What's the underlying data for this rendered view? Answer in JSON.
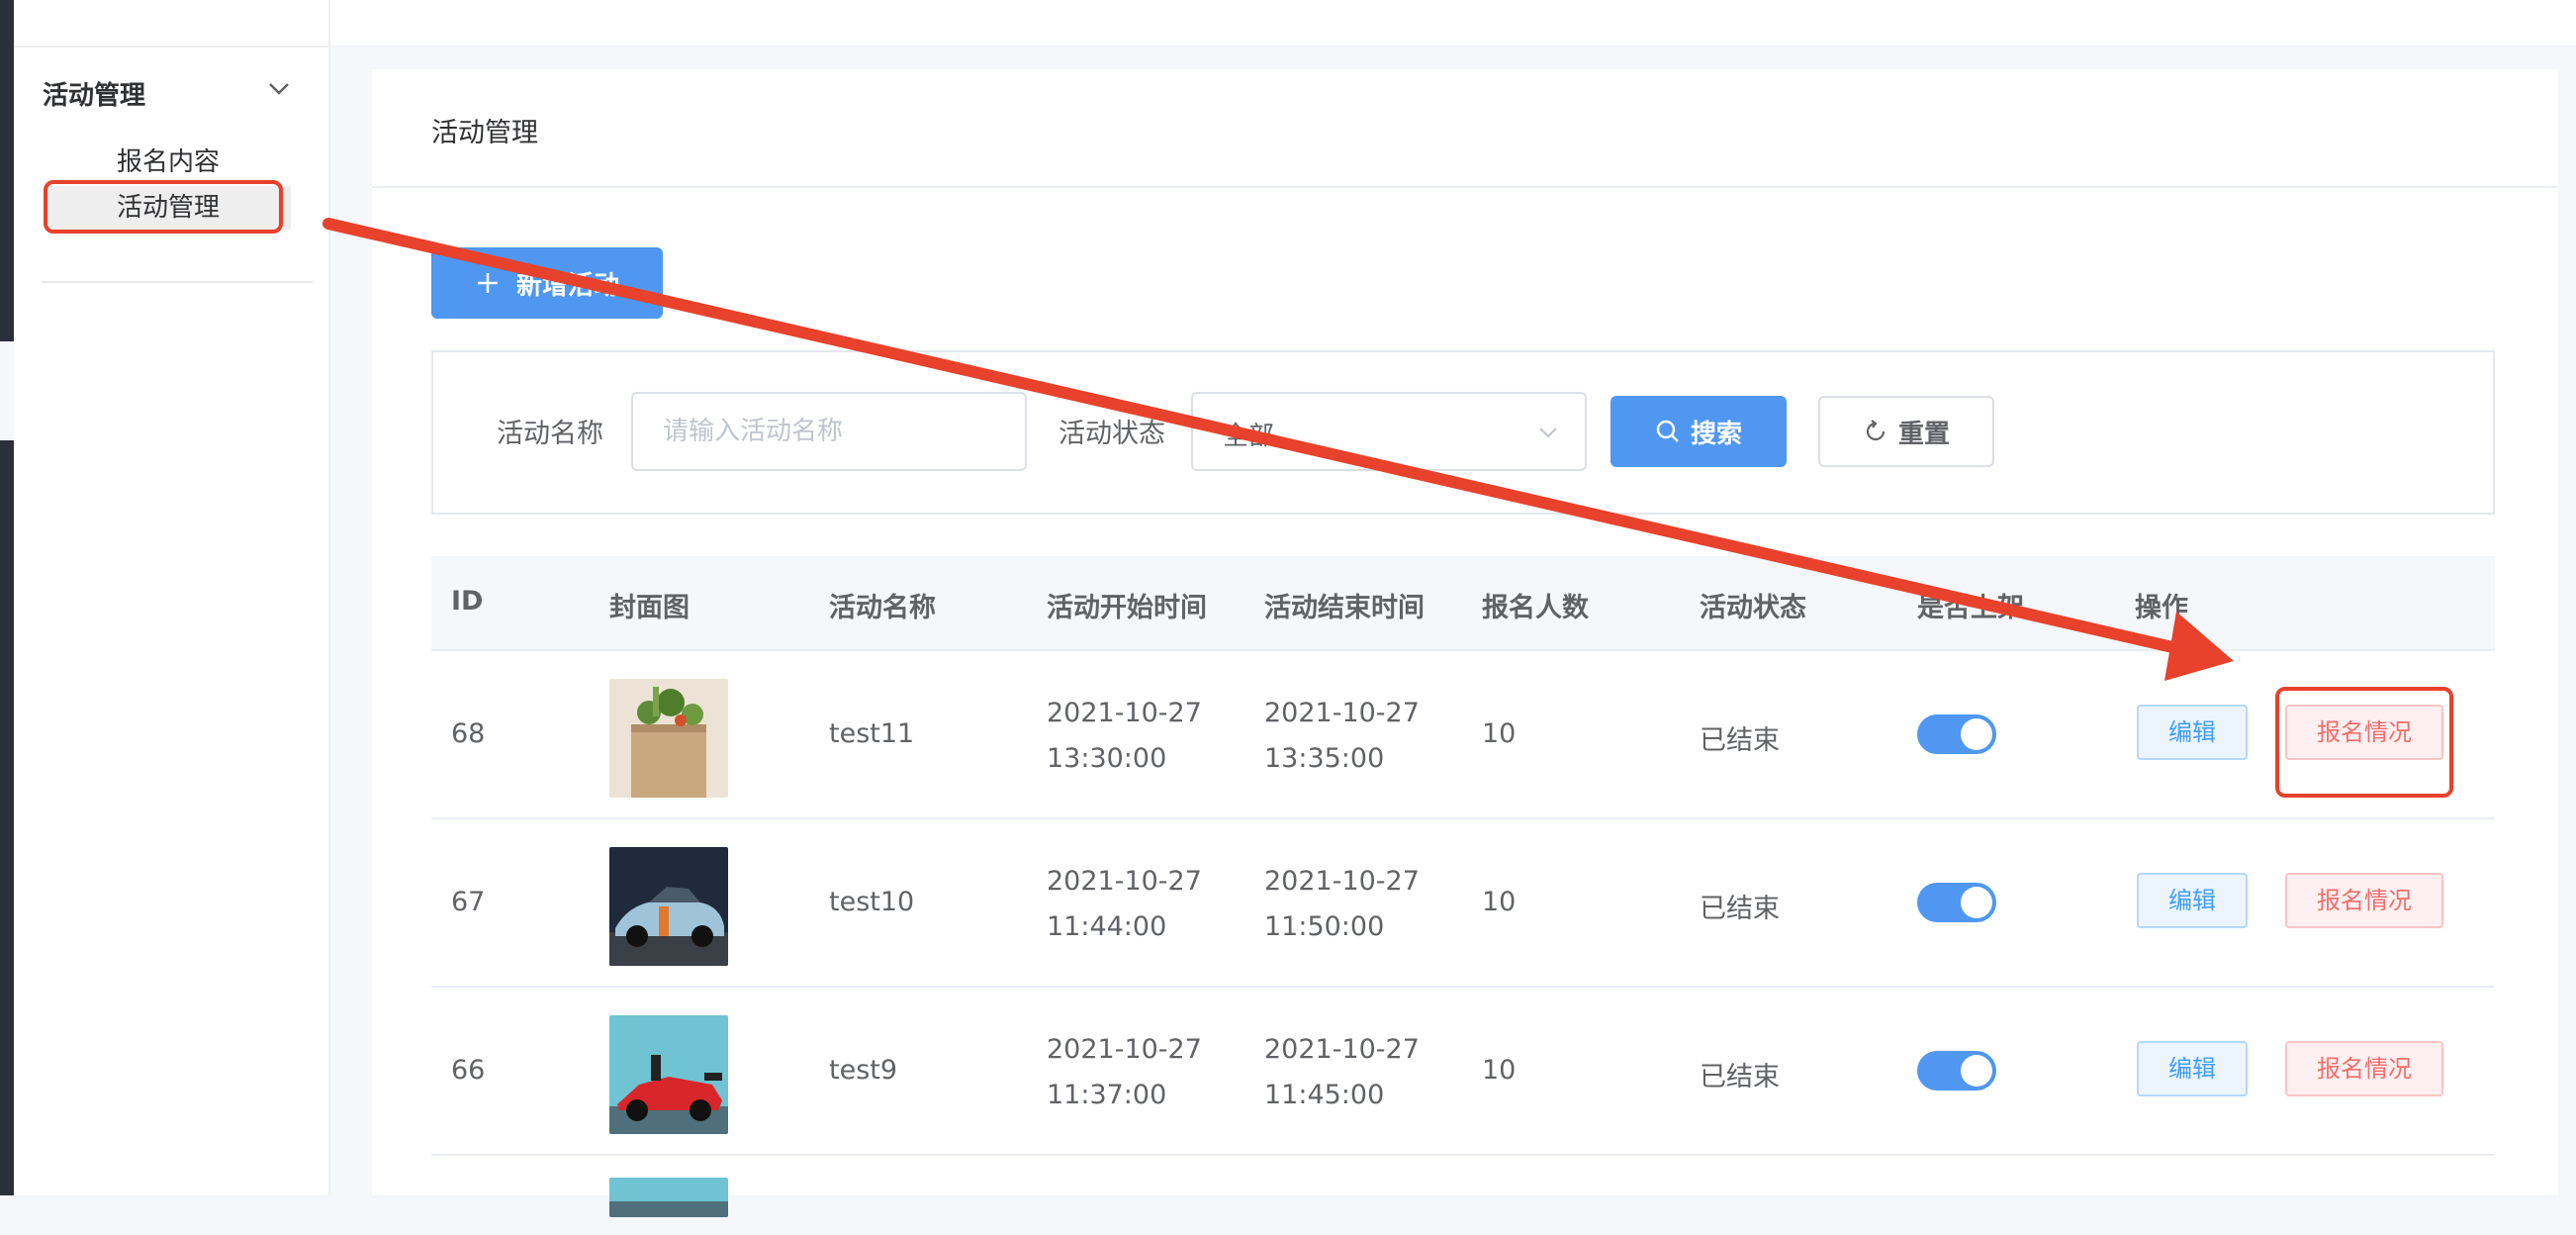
{
  "sidebar": {
    "group_title": "活动管理",
    "items": [
      {
        "label": "报名内容"
      },
      {
        "label": "活动管理"
      }
    ]
  },
  "card": {
    "title": "活动管理",
    "add_button": "新增活动"
  },
  "filter": {
    "name_label": "活动名称",
    "name_placeholder": "请输入活动名称",
    "status_label": "活动状态",
    "status_value": "全部",
    "search_button": "搜索",
    "reset_button": "重置"
  },
  "table": {
    "headers": [
      "ID",
      "封面图",
      "活动名称",
      "活动开始时间",
      "活动结束时间",
      "报名人数",
      "活动状态",
      "是否上架",
      "操作"
    ],
    "rows": [
      {
        "id": "68",
        "name": "test11",
        "start_date": "2021-10-27",
        "start_time": "13:30:00",
        "end_date": "2021-10-27",
        "end_time": "13:35:00",
        "count": "10",
        "status": "已结束",
        "listed": true,
        "cover": "groceries-bag"
      },
      {
        "id": "67",
        "name": "test10",
        "start_date": "2021-10-27",
        "start_time": "11:44:00",
        "end_date": "2021-10-27",
        "end_time": "11:50:00",
        "count": "10",
        "status": "已结束",
        "listed": true,
        "cover": "race-car"
      },
      {
        "id": "66",
        "name": "test9",
        "start_date": "2021-10-27",
        "start_time": "11:37:00",
        "end_date": "2021-10-27",
        "end_time": "11:45:00",
        "count": "10",
        "status": "已结束",
        "listed": true,
        "cover": "formula-car"
      }
    ],
    "edit_label": "编辑",
    "registration_label": "报名情况"
  },
  "colors": {
    "primary": "#4f97f0",
    "annotation": "#e8412c",
    "danger_text": "#f56c6c"
  }
}
